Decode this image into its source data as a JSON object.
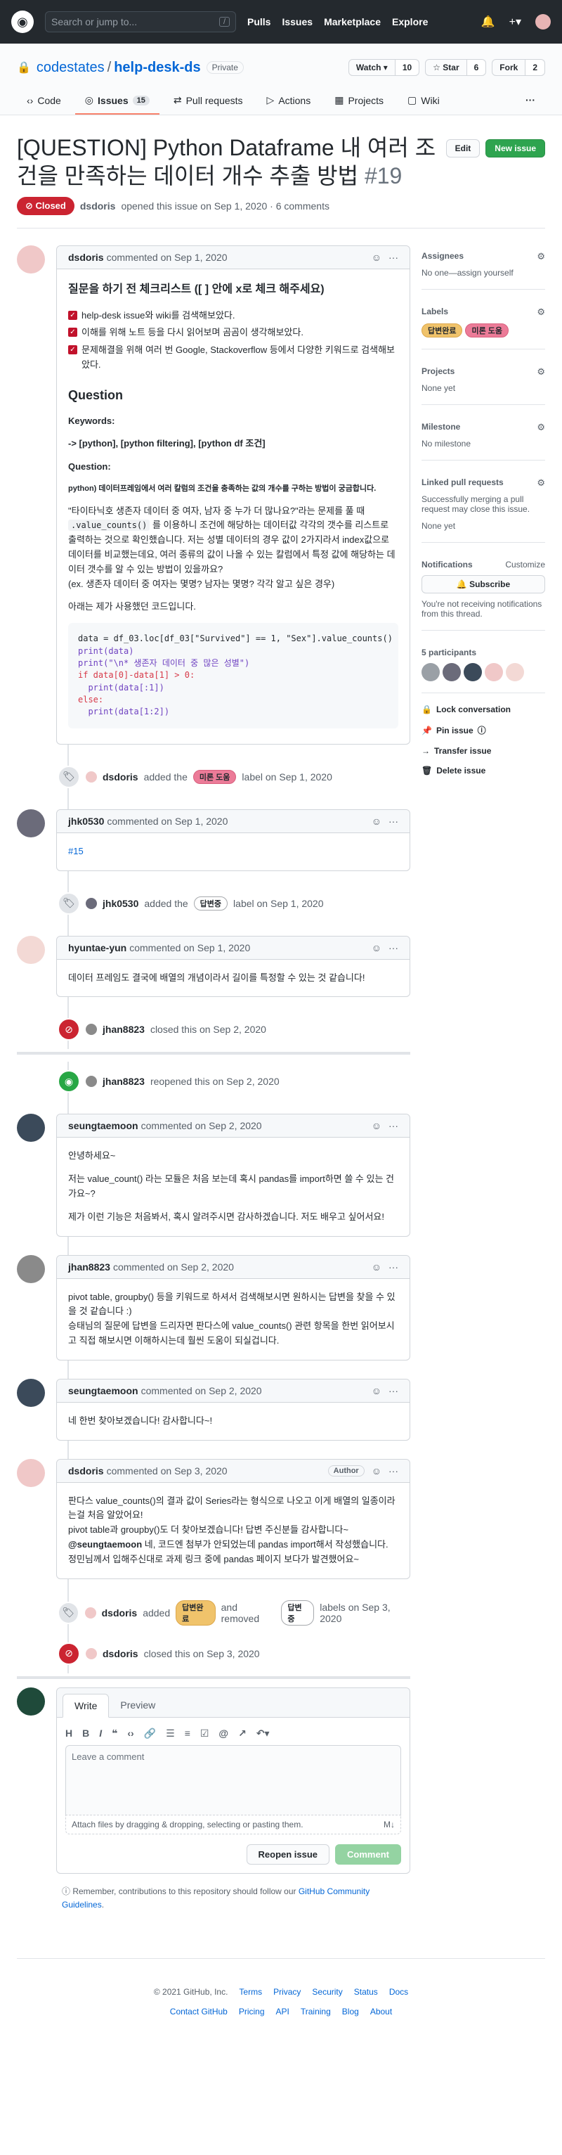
{
  "header": {
    "search_placeholder": "Search or jump to...",
    "slash": "/",
    "nav": [
      "Pulls",
      "Issues",
      "Marketplace",
      "Explore"
    ],
    "bell_icon": "bell-icon",
    "plus": "+▾"
  },
  "repo": {
    "owner": "codestates",
    "separator": "/",
    "name": "help-desk-ds",
    "visibility": "Private",
    "watch_label": "Watch ▾",
    "watch_count": "10",
    "star_label": "☆ Star",
    "star_count": "6",
    "fork_label": "Fork",
    "fork_count": "2",
    "tabs": [
      {
        "label": "Code",
        "icon": "‹›"
      },
      {
        "label": "Issues",
        "icon": "◎",
        "count": "15"
      },
      {
        "label": "Pull requests",
        "icon": "⇄"
      },
      {
        "label": "Actions",
        "icon": "▷"
      },
      {
        "label": "Projects",
        "icon": "▦"
      },
      {
        "label": "Wiki",
        "icon": "▢"
      }
    ],
    "more": "···"
  },
  "issue": {
    "title": "[QUESTION] Python Dataframe 내 여러 조건을 만족하는 데이터 개수 추출 방법",
    "number": "#19",
    "edit_label": "Edit",
    "new_issue_label": "New issue",
    "state": "Closed",
    "author": "dsdoris",
    "opened_text": "opened this issue on Sep 1, 2020 · 6 comments"
  },
  "first_comment": {
    "author": "dsdoris",
    "when": "commented on Sep 1, 2020",
    "checklist_title": "질문을 하기 전 체크리스트 ([ ] 안에 x로 체크 해주세요)",
    "checklist": [
      "help-desk issue와 wiki를 검색해보았다.",
      "이해를 위해 노트 등을 다시 읽어보며 곰곰이 생각해보았다.",
      "문제해결을 위해 여러 번 Google, Stackoverflow 등에서 다양한 키워드로 검색해보았다."
    ],
    "question_heading": "Question",
    "keywords_label": "Keywords:",
    "keywords": "-> [python], [python filtering], [python df 조건]",
    "question_label": "Question:",
    "question_text": "python) 데이터프레임에서 여러 칼럼의 조건을 충족하는 값의 개수를 구하는 방법이 궁금합니다.",
    "body1_a": "\"타이타닉호 생존자 데이터 중 여자, 남자 중 누가 더 많나요?\"라는 문제를 풀 때 ",
    "body1_code": ".value_counts()",
    "body1_b": " 를 이용하니 조건에 해당하는 데이터값 각각의 갯수를 리스트로 출력하는 것으로 확인했습니다. 저는 성별 데이터의 경우 값이 2가지라서 index값으로 데이터를 비교했는데요, 여러 종류의 값이 나올 수 있는 칼럼에서 특정 값에 해당하는 데이터 갯수를 알 수 있는 방법이 있을까요?",
    "body1_c": "(ex. 생존자 데이터 중 여자는 몇명? 남자는 몇명? 각각 알고 싶은 경우)",
    "body2": "아래는 제가 사용했던 코드입니다.",
    "code": [
      "data = df_03.loc[df_03[\"Survived\"] == 1, \"Sex\"].value_counts()",
      "print(data)",
      "print(\"\\n* 생존자 데이터 중 많은 성별\")",
      "if data[0]-data[1] > 0:",
      "  print(data[:1])",
      "else:",
      "  print(data[1:2])"
    ]
  },
  "events": {
    "label_added": {
      "actor": "dsdoris",
      "pre": "added the",
      "label": "미론 도움",
      "post": "label on Sep 1, 2020"
    },
    "jhk_comment": {
      "author": "jhk0530",
      "when": "commented on Sep 1, 2020",
      "body": "#15"
    },
    "jhk_label": {
      "actor": "jhk0530",
      "pre": "added the",
      "label": "답변중",
      "post": "label on Sep 1, 2020"
    },
    "hyuntae_comment": {
      "author": "hyuntae-yun",
      "when": "commented on Sep 1, 2020",
      "body": "데이터 프레임도 결국에 배열의 개념이라서 길이를 특정할 수 있는 것 같습니다!"
    },
    "closed1": {
      "actor": "jhan8823",
      "text": "closed this on Sep 2, 2020"
    },
    "reopened": {
      "actor": "jhan8823",
      "text": "reopened this on Sep 2, 2020"
    },
    "seung_comment1": {
      "author": "seungtaemoon",
      "when": "commented on Sep 2, 2020",
      "p1": "안녕하세요~",
      "p2": "저는 value_count() 라는 모듈은 처음 보는데 혹시 pandas를 import하면 쓸 수 있는 건가요~?",
      "p3": "제가 이런 기능은 처음봐서, 혹시 알려주시면 감사하겠습니다. 저도 배우고 싶어서요!"
    },
    "jhan_comment": {
      "author": "jhan8823",
      "when": "commented on Sep 2, 2020",
      "p1": "pivot table, groupby() 등을 키워드로 하셔서 검색해보시면 원하시는 답변을 찾을 수 있을 것 같습니다 :)",
      "p2": "승태님의 질문에 답변을 드리자면 판다스에 value_counts() 관련 항목을 한번 읽어보시고 직접 해보시면 이해하시는데 훨씬 도움이 되실겁니다."
    },
    "seung_comment2": {
      "author": "seungtaemoon",
      "when": "commented on Sep 2, 2020",
      "body": "네 한번 찾아보겠습니다! 감사합니다~!"
    },
    "doris_comment": {
      "author": "dsdoris",
      "when": "commented on Sep 3, 2020",
      "author_label": "Author",
      "p1": "판다스 value_counts()의 결과 값이 Series라는 형식으로 나오고 이게 배열의 일종이라는걸 처음 알았어요!",
      "p2": "pivot table과 groupby()도 더 찾아보겠습니다! 답변 주신분들 감사합니다~",
      "mention": "@seungtaemoon",
      "p3": " 네, 코드엔 첨부가 안되었는데 pandas import해서 작성했습니다. 정민님께서 입해주신대로 과제 링크 중에 pandas 페이지 보다가 발견했어요~"
    },
    "labels_changed": {
      "actor": "dsdoris",
      "pre": "added",
      "added": "답변완료",
      "mid": "and removed",
      "removed": "답변중",
      "post": "labels on Sep 3, 2020"
    },
    "closed2": {
      "actor": "dsdoris",
      "text": "closed this on Sep 3, 2020"
    }
  },
  "editor": {
    "tab_write": "Write",
    "tab_preview": "Preview",
    "toolbar": [
      "H",
      "B",
      "I",
      "❝",
      "‹›",
      "🔗",
      "☰",
      "≡",
      "☑",
      "@",
      "↗",
      "↶▾"
    ],
    "placeholder": "Leave a comment",
    "attach": "Attach files by dragging & dropping, selecting or pasting them.",
    "md": "M↓",
    "reopen": "Reopen issue",
    "comment": "Comment"
  },
  "note": {
    "pre": "Remember, contributions to this repository should follow our ",
    "link": "GitHub Community Guidelines",
    "post": "."
  },
  "sidebar": {
    "assignees": "Assignees",
    "assignees_value": "No one—assign yourself",
    "labels": "Labels",
    "labels_values": [
      "답변완료",
      "미론 도움"
    ],
    "projects": "Projects",
    "projects_value": "None yet",
    "milestone": "Milestone",
    "milestone_value": "No milestone",
    "linked": "Linked pull requests",
    "linked_desc": "Successfully merging a pull request may close this issue.",
    "linked_value": "None yet",
    "notifications": "Notifications",
    "customize": "Customize",
    "subscribe": "🔔 Subscribe",
    "notif_desc": "You're not receiving notifications from this thread.",
    "participants": "5 participants",
    "lock": "Lock conversation",
    "pin": "Pin issue",
    "transfer": "Transfer issue",
    "delete": "Delete issue"
  },
  "footer": {
    "copyright": "© 2021 GitHub, Inc.",
    "row1": [
      "Terms",
      "Privacy",
      "Security",
      "Status",
      "Docs"
    ],
    "row2": [
      "Contact GitHub",
      "Pricing",
      "API",
      "Training",
      "Blog",
      "About"
    ]
  },
  "colors": {
    "closed": "#cb2431",
    "open": "#28a745",
    "accent": "#0366d6",
    "label_yellow": "#f0c36b",
    "label_pink": "#ec7b98"
  }
}
